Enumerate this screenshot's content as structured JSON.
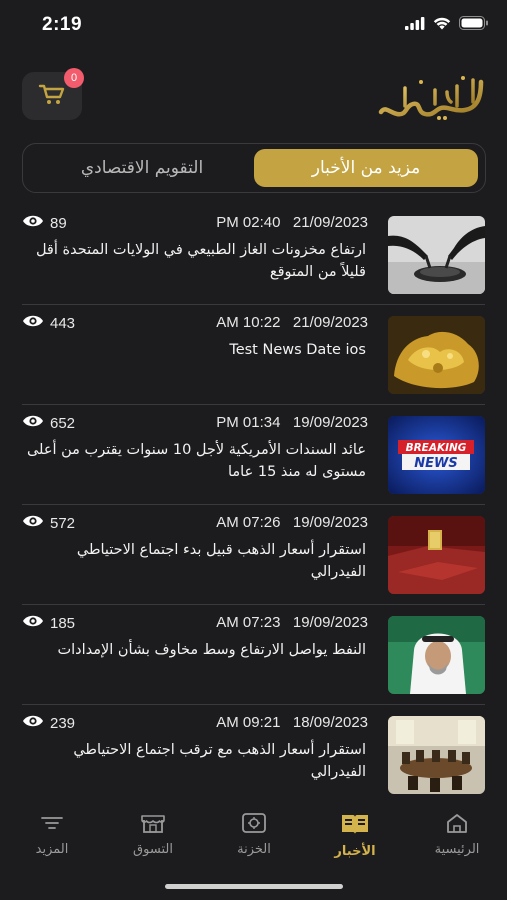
{
  "status_bar": {
    "time": "2:19"
  },
  "header": {
    "cart_count": "0"
  },
  "tabs": {
    "active": "مزيد من الأخبار",
    "inactive": "التقويم الاقتصادي"
  },
  "news": [
    {
      "views": "89",
      "datetime": "PM 02:40   21/09/2023",
      "title": "ارتفاع مخزونات الغاز الطبيعي في الولايات المتحدة أقل قليلاً من المتوقع"
    },
    {
      "views": "443",
      "datetime": "AM 10:22   21/09/2023",
      "title": "Test News Date ios"
    },
    {
      "views": "652",
      "datetime": "PM 01:34   19/09/2023",
      "title": "عائد السندات الأمريكية لأجل 10 سنوات يقترب من أعلى مستوى له منذ 15 عاما"
    },
    {
      "views": "572",
      "datetime": "AM 07:26   19/09/2023",
      "title": "استقرار أسعار الذهب قبيل بدء اجتماع الاحتياطي الفيدرالي"
    },
    {
      "views": "185",
      "datetime": "AM 07:23   19/09/2023",
      "title": "النفط يواصل الارتفاع وسط مخاوف بشأن الإمدادات"
    },
    {
      "views": "239",
      "datetime": "AM 09:21   18/09/2023",
      "title": "استقرار أسعار الذهب مع ترقب اجتماع الاحتياطي الفيدرالي"
    }
  ],
  "breaking_image": {
    "line1": "BREAKING",
    "line2": "NEWS"
  },
  "nav": {
    "home": "الرئيسية",
    "news": "الأخبار",
    "vault": "الخزنة",
    "shopping": "التسوق",
    "more": "المزيد"
  },
  "colors": {
    "gold": "#c3a342",
    "background": "#1c1c1e",
    "badge": "#f25c6c"
  }
}
